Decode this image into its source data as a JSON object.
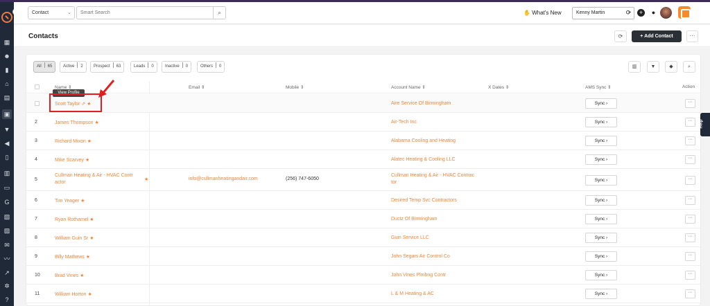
{
  "header": {
    "module_select": "Contact",
    "search_placeholder": "Smart Search",
    "whats_new": "What's New",
    "user_select": "Kenny Martin"
  },
  "page": {
    "title": "Contacts",
    "add_button": "+ Add Contact"
  },
  "filters": [
    {
      "label": "All",
      "count": "65",
      "active": true
    },
    {
      "label": "Active",
      "count": "2"
    },
    {
      "label": "Prospect",
      "count": "63"
    },
    {
      "label": "Leads",
      "count": "0"
    },
    {
      "label": "Inactive",
      "count": "0"
    },
    {
      "label": "Others",
      "count": "0"
    }
  ],
  "columns": {
    "name": "Name ⇕",
    "email": "Email ⇕",
    "mobile": "Mobile ⇕",
    "account": "Account Name ⇕",
    "xdates": "X Dates ⇕",
    "ams": "AMS Sync ⇕",
    "action": "Action"
  },
  "tooltip": "View Profile",
  "sync_label": "Sync  ›",
  "help_label": "Help",
  "rows": [
    {
      "num": "",
      "name": "Scott Taylor",
      "email": "",
      "mobile": "",
      "account": "Aire Service Of Birmingham"
    },
    {
      "num": "2",
      "name": "James Thompson",
      "email": "",
      "mobile": "",
      "account": "Air-Tech Inc"
    },
    {
      "num": "3",
      "name": "Richard Mixon",
      "email": "",
      "mobile": "",
      "account": "Alabama Cooling and Heating"
    },
    {
      "num": "4",
      "name": "Mike Scarvey",
      "email": "",
      "mobile": "",
      "account": "Alatec Heating & Cooling LLC"
    },
    {
      "num": "5",
      "name": "Cullman Heating & Air - HVAC Contr",
      "name2": "actor",
      "email": "info@cullmanheatingandair.com",
      "mobile": "(256) 747-6050",
      "account": "Cullman Heating & Air - HVAC Contrac",
      "account2": "tor"
    },
    {
      "num": "6",
      "name": "Tim Yeager",
      "email": "",
      "mobile": "",
      "account": "Desired Temp Svc Contractors"
    },
    {
      "num": "7",
      "name": "Ryan Rothamel",
      "email": "",
      "mobile": "",
      "account": "Ductz Of Birmingham"
    },
    {
      "num": "8",
      "name": "William Guin Sr",
      "email": "",
      "mobile": "",
      "account": "Guin Service LLC"
    },
    {
      "num": "9",
      "name": "Billy Mathews",
      "email": "",
      "mobile": "",
      "account": "John Segars Air Control Co"
    },
    {
      "num": "10",
      "name": "Brad Vines",
      "email": "",
      "mobile": "",
      "account": "John Vines Plmbng Contr"
    },
    {
      "num": "11",
      "name": "William Horton",
      "email": "",
      "mobile": "",
      "account": "L & M Heating & AC"
    }
  ]
}
